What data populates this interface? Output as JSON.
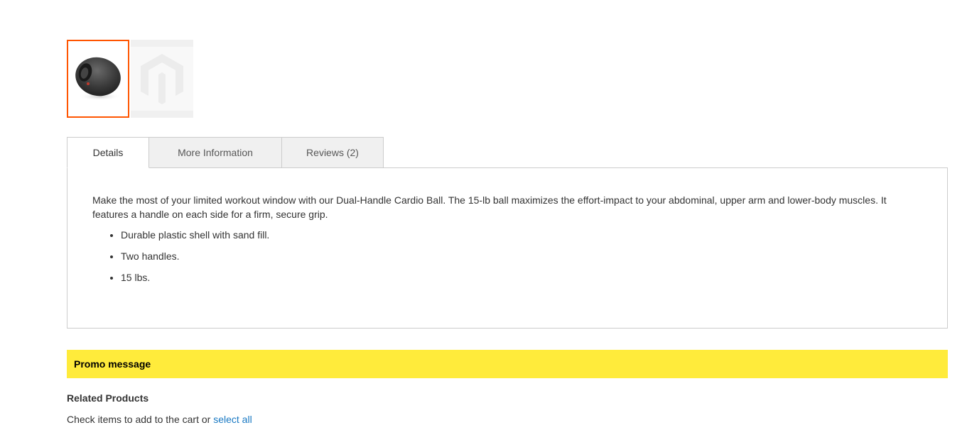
{
  "gallery": {
    "thumbnails": [
      {
        "icon": "cardio-ball-product-image",
        "active": true
      },
      {
        "icon": "magento-logo-placeholder",
        "active": false
      }
    ],
    "active_border_color": "#ff5501"
  },
  "tabs": [
    {
      "label": "Details",
      "active": true
    },
    {
      "label": "More Information",
      "active": false
    },
    {
      "label": "Reviews (2)",
      "active": false
    }
  ],
  "details": {
    "description": "Make the most of your limited workout window with our Dual-Handle Cardio Ball. The 15-lb ball maximizes the effort-impact to your abdominal, upper arm and lower-body muscles. It features a handle on each side for a firm, secure grip.",
    "features": [
      "Durable plastic shell with sand fill.",
      "Two handles.",
      "15 lbs."
    ]
  },
  "promo": {
    "text": "Promo message",
    "background_color": "#ffeb3b"
  },
  "related": {
    "title": "Related Products",
    "instruction": "Check items to add to the cart or",
    "select_all_label": "select all",
    "link_color": "#1979c3"
  }
}
